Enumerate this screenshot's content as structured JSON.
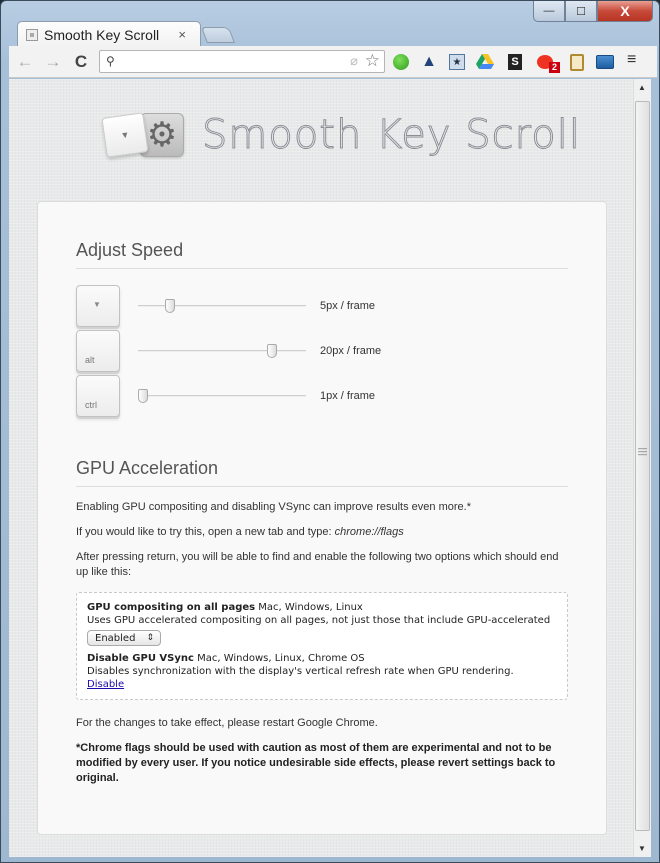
{
  "window": {
    "minimize_label": "—",
    "maximize_label": "☐",
    "close_label": "X"
  },
  "tab": {
    "title": "Smooth Key Scroll",
    "close_label": "×"
  },
  "toolbar": {
    "back_icon": "←",
    "forward_icon": "→",
    "reload_icon": "C",
    "search_icon": "⚲",
    "omnibox_value": "",
    "omnibox_placeholder": "",
    "tag_icon": "⌀",
    "star_icon": "☆",
    "menu_icon": "≡",
    "extensions": [
      {
        "name": "green-orb-extension"
      },
      {
        "name": "shark-extension",
        "glyph": "▲"
      },
      {
        "name": "bookmark-star-extension",
        "glyph": "★"
      },
      {
        "name": "google-drive-extension"
      },
      {
        "name": "script-extension",
        "glyph": "S"
      },
      {
        "name": "notification-bubble-extension",
        "badge": "2"
      },
      {
        "name": "clipboard-extension"
      },
      {
        "name": "window-extension"
      }
    ]
  },
  "logo": {
    "key_glyph": "▼",
    "gear_glyph": "⚙",
    "title": "Smooth Key Scroll"
  },
  "speed": {
    "heading": "Adjust Speed",
    "rows": [
      {
        "key": "",
        "key_glyph": "▼",
        "value": 5,
        "max": 50,
        "label": "5px / frame"
      },
      {
        "key": "alt",
        "key_glyph": "",
        "value": 20,
        "max": 50,
        "label": "20px / frame"
      },
      {
        "key": "ctrl",
        "key_glyph": "",
        "value": 1,
        "max": 50,
        "label": "1px / frame"
      }
    ]
  },
  "gpu": {
    "heading": "GPU Acceleration",
    "p1": "Enabling GPU compositing and disabling VSync can improve results even more.*",
    "p2_prefix": "If you would like to try this, open a new tab and type: ",
    "p2_code": "chrome://flags",
    "p3": "After pressing return, you will be able to find and enable the following two options which should end up like this:",
    "flag1": {
      "name": "GPU compositing on all pages",
      "platforms": " Mac, Windows, Linux",
      "desc": "Uses GPU accelerated compositing on all pages, not just those that include GPU-accelerated",
      "select_value": "Enabled",
      "select_arrows": "⇕"
    },
    "flag2": {
      "name": "Disable GPU VSync",
      "platforms": " Mac, Windows, Linux, Chrome OS",
      "desc": "Disables synchronization with the display's vertical refresh rate when GPU rendering.",
      "link": "Disable"
    },
    "p4": "For the changes to take effect, please restart Google Chrome.",
    "warning": "*Chrome flags should be used with caution as most of them are experimental and not to be modified by every user. If you notice undesirable side effects, please revert settings back to original."
  },
  "scrollbar": {
    "up_icon": "▲",
    "down_icon": "▼",
    "grip_icon": "≡"
  }
}
